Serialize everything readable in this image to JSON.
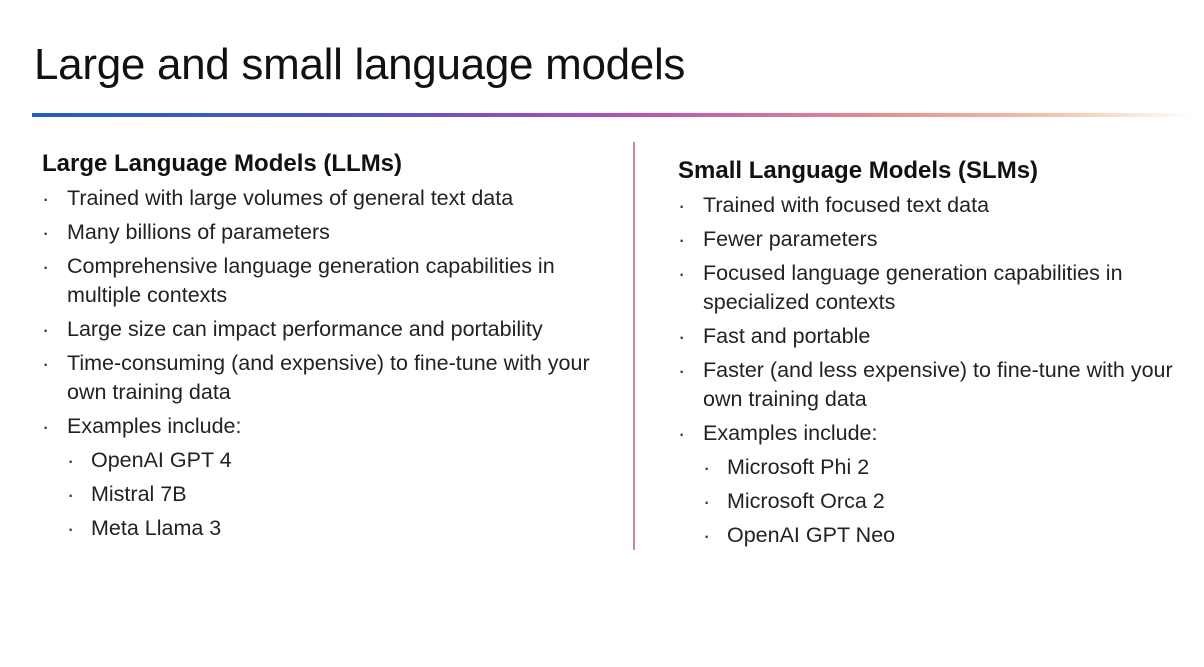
{
  "slide": {
    "title": "Large and small language models"
  },
  "llm": {
    "heading": "Large Language Models (LLMs)",
    "items": [
      "Trained with large volumes of general text data",
      "Many billions of parameters",
      "Comprehensive language generation capabilities in multiple contexts",
      "Large size can impact performance and portability",
      "Time-consuming (and expensive) to fine-tune with your own training data",
      "Examples include:"
    ],
    "examples": [
      "OpenAI GPT 4",
      "Mistral 7B",
      "Meta Llama 3"
    ]
  },
  "slm": {
    "heading": "Small Language Models (SLMs)",
    "items": [
      "Trained with focused text data",
      "Fewer parameters",
      "Focused language generation capabilities in specialized contexts",
      "Fast and portable",
      "Faster (and less expensive) to fine-tune with your own training data",
      "Examples include:"
    ],
    "examples": [
      "Microsoft Phi 2",
      "Microsoft Orca 2",
      "OpenAI GPT Neo"
    ]
  },
  "colors": {
    "title_rule_start": "#1f5fbf",
    "title_rule_mid": "#b14fbe",
    "title_rule_end": "#f4c4a8",
    "divider": "#c98d93"
  }
}
